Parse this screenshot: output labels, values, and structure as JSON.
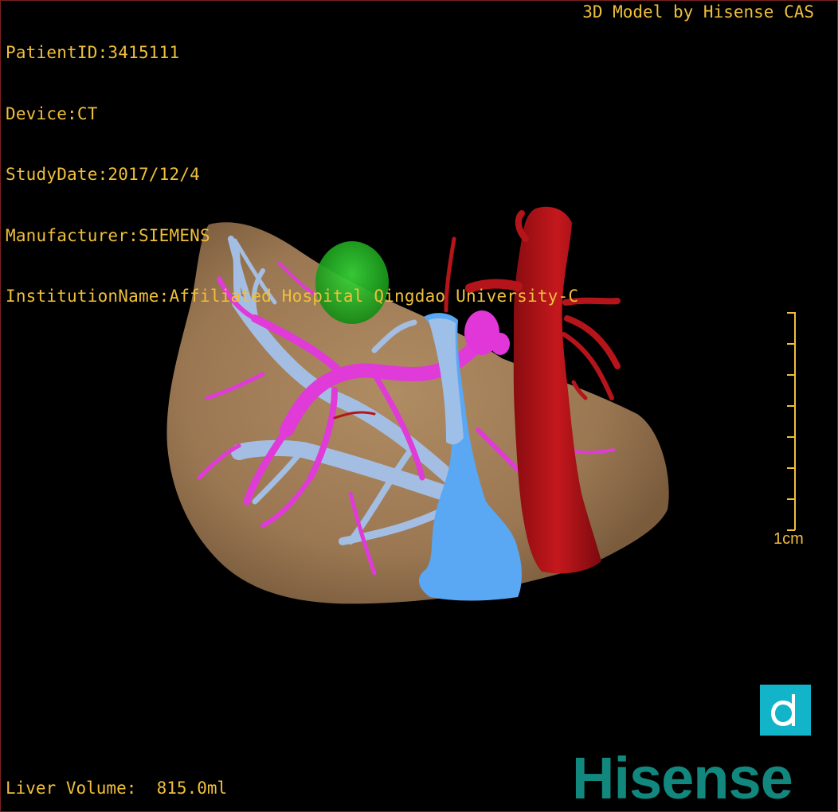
{
  "overlay": {
    "patient_id": "PatientID:3415111",
    "device": "Device:CT",
    "study_date": "StudyDate:2017/12/4",
    "manufacturer": "Manufacturer:SIEMENS",
    "institution": "InstitutionName:Affiliated Hospital Qingdao University-C",
    "credit": "3D Model by Hisense CAS",
    "liver_volume": "Liver Volume:  815.0ml"
  },
  "scale_bar": {
    "label": "1cm"
  },
  "branding": {
    "logo_text": "Hisense",
    "badge_letter": "d"
  },
  "colors": {
    "overlay_text": "#f0bf3c",
    "liver": "#9c7a55",
    "portal_vein": "#e237d8",
    "hepatic_vein": "#9fbce6",
    "ivc": "#5aa6f2",
    "artery": "#b31217",
    "tumor": "#1fae1f",
    "badge": "#11b4c8",
    "logo": "#12877d"
  }
}
